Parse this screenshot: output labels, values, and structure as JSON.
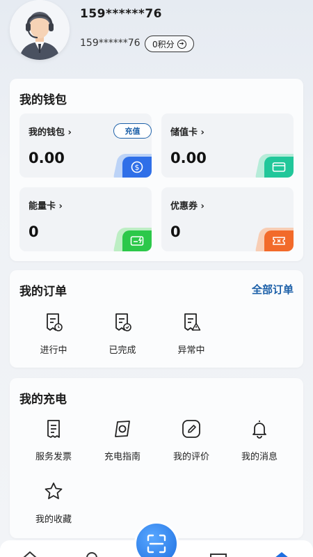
{
  "user": {
    "name": "159******76",
    "phone": "159******76",
    "points_label": "0积分"
  },
  "wallet": {
    "title": "我的钱包",
    "recharge_label": "充值",
    "tiles": [
      {
        "label": "我的钱包",
        "value": "0.00",
        "icon": "dollar-coin-icon",
        "color": "#2f6fe8"
      },
      {
        "label": "储值卡",
        "value": "0.00",
        "icon": "card-icon",
        "color": "#21c79a"
      },
      {
        "label": "能量卡",
        "value": "0",
        "icon": "energy-card-icon",
        "color": "#2cc84a"
      },
      {
        "label": "优惠券",
        "value": "0",
        "icon": "coupon-icon",
        "color": "#f26a2a"
      }
    ]
  },
  "orders": {
    "title": "我的订单",
    "all_label": "全部订单",
    "items": [
      {
        "label": "进行中",
        "icon": "order-in-progress-icon"
      },
      {
        "label": "已完成",
        "icon": "order-completed-icon"
      },
      {
        "label": "异常中",
        "icon": "order-exception-icon"
      }
    ]
  },
  "charging": {
    "title": "我的充电",
    "items": [
      {
        "label": "服务发票",
        "icon": "invoice-icon"
      },
      {
        "label": "充电指南",
        "icon": "guide-icon"
      },
      {
        "label": "我的评价",
        "icon": "edit-review-icon"
      },
      {
        "label": "我的消息",
        "icon": "bell-icon"
      },
      {
        "label": "我的收藏",
        "icon": "star-icon"
      }
    ]
  },
  "nav": {
    "center_icon": "scan-icon"
  },
  "colors": {
    "accent": "#1b5fa8",
    "scan": "#1e6fe0"
  }
}
